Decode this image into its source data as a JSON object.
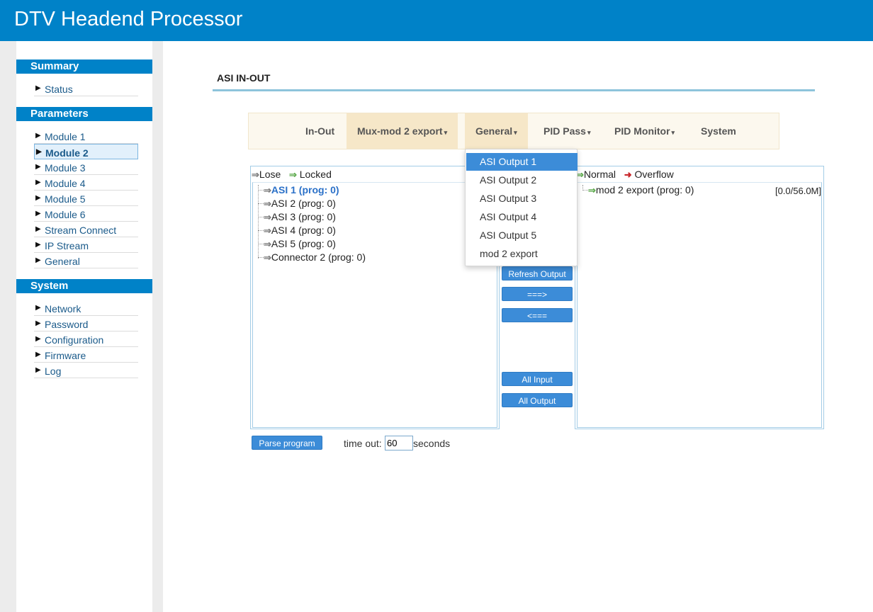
{
  "app": {
    "title": "DTV Headend Processor"
  },
  "sidebar": {
    "summary": {
      "heading": "Summary",
      "items": [
        "Status"
      ]
    },
    "parameters": {
      "heading": "Parameters",
      "items": [
        "Module 1",
        "Module 2",
        "Module 3",
        "Module 4",
        "Module 5",
        "Module 6",
        "Stream Connect",
        "IP Stream",
        "General"
      ],
      "active": "Module 2"
    },
    "system": {
      "heading": "System",
      "items": [
        "Network",
        "Password",
        "Configuration",
        "Firmware",
        "Log"
      ]
    }
  },
  "page": {
    "title": "ASI IN-OUT"
  },
  "tabs": [
    {
      "label": "In-Out",
      "caret": ""
    },
    {
      "label": "Mux-mod 2 export",
      "caret": "▾"
    },
    {
      "label": "General",
      "caret": "▾"
    },
    {
      "label": "PID Pass",
      "caret": "▾"
    },
    {
      "label": "PID Monitor",
      "caret": "▾"
    },
    {
      "label": "System",
      "caret": ""
    }
  ],
  "dropdown": {
    "items": [
      "ASI Output 1",
      "ASI Output 2",
      "ASI Output 3",
      "ASI Output 4",
      "ASI Output 5",
      "mod 2 export"
    ],
    "highlighted": "ASI Output 1"
  },
  "input_panel": {
    "legend": {
      "lose": "Lose",
      "locked": "Locked"
    },
    "items": [
      "ASI 1 (prog: 0)",
      "ASI 2 (prog: 0)",
      "ASI 3 (prog: 0)",
      "ASI 4 (prog: 0)",
      "ASI 5 (prog: 0)",
      "Connector 2 (prog: 0)"
    ],
    "selected": "ASI 1 (prog: 0)"
  },
  "output_panel": {
    "legend": {
      "normal": "Normal",
      "overflow": "Overflow"
    },
    "items": [
      "mod 2 export (prog: 0)"
    ],
    "rate": "[0.0/56.0M]"
  },
  "buttons": {
    "refresh_output": "Refresh Output",
    "move_right": "===>",
    "move_left": "<===",
    "all_input": "All Input",
    "all_output": "All Output",
    "parse_program": "Parse program"
  },
  "timeout": {
    "label": "time out:",
    "value": "60",
    "unit": "seconds"
  },
  "colors": {
    "brand": "#0082c8",
    "button": "#3c8cd8",
    "tab_selected": "#f6e7c8",
    "locked_arrow": "#5aa84a",
    "overflow_arrow": "#c8262a"
  }
}
